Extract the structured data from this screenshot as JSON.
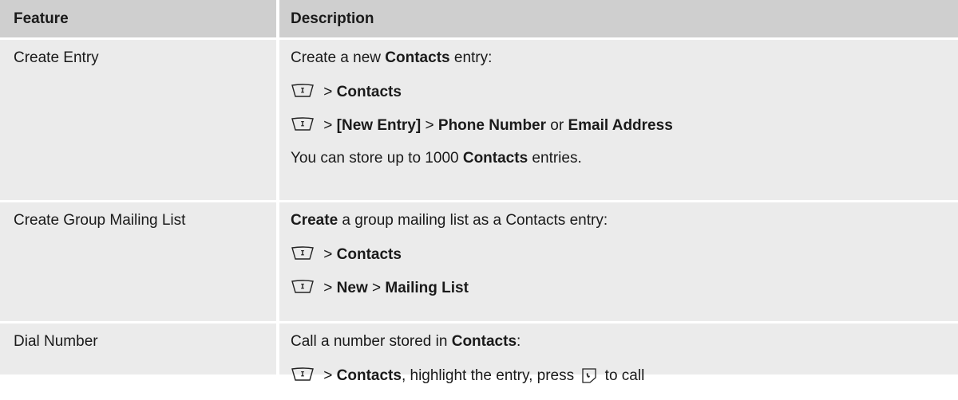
{
  "headers": {
    "feature": "Feature",
    "description": "Description"
  },
  "rows": [
    {
      "feature": "Create Entry",
      "lines": [
        [
          {
            "t": "Create a new ",
            "b": false
          },
          {
            "t": "Contacts",
            "b": true
          },
          {
            "t": " entry:",
            "b": false
          }
        ],
        [
          {
            "icon": "menu-key-icon"
          },
          {
            "t": " > ",
            "b": false
          },
          {
            "t": "Contacts",
            "b": true
          }
        ],
        [
          {
            "icon": "menu-key-icon"
          },
          {
            "t": " > ",
            "b": false
          },
          {
            "t": "[New Entry]",
            "b": true
          },
          {
            "t": " > ",
            "b": false
          },
          {
            "t": "Phone Number",
            "b": true
          },
          {
            "t": " or ",
            "b": false
          },
          {
            "t": "Email Address",
            "b": true
          }
        ],
        [
          {
            "t": "You can store up to 1000 ",
            "b": false
          },
          {
            "t": "Contacts",
            "b": true
          },
          {
            "t": " entries.",
            "b": false
          }
        ]
      ]
    },
    {
      "feature": "Create Group Mailing List",
      "lines": [
        [
          {
            "t": "Create",
            "b": true
          },
          {
            "t": " a group mailing list as a Contacts entry:",
            "b": false
          }
        ],
        [
          {
            "icon": "menu-key-icon"
          },
          {
            "t": " > ",
            "b": false
          },
          {
            "t": "Contacts",
            "b": true
          }
        ],
        [
          {
            "icon": "menu-key-icon"
          },
          {
            "t": " > ",
            "b": false
          },
          {
            "t": "New",
            "b": true
          },
          {
            "t": " > ",
            "b": false
          },
          {
            "t": "Mailing List",
            "b": true
          }
        ]
      ]
    },
    {
      "feature": "Dial Number",
      "lines": [
        [
          {
            "t": "Call a number stored in ",
            "b": false
          },
          {
            "t": "Contacts",
            "b": true
          },
          {
            "t": ":",
            "b": false
          }
        ],
        [
          {
            "icon": "menu-key-icon"
          },
          {
            "t": " > ",
            "b": false
          },
          {
            "t": "Contacts",
            "b": true
          },
          {
            "t": ", highlight the entry, press ",
            "b": false
          },
          {
            "icon": "send-key-icon"
          },
          {
            "t": " to call",
            "b": false
          }
        ]
      ]
    }
  ]
}
